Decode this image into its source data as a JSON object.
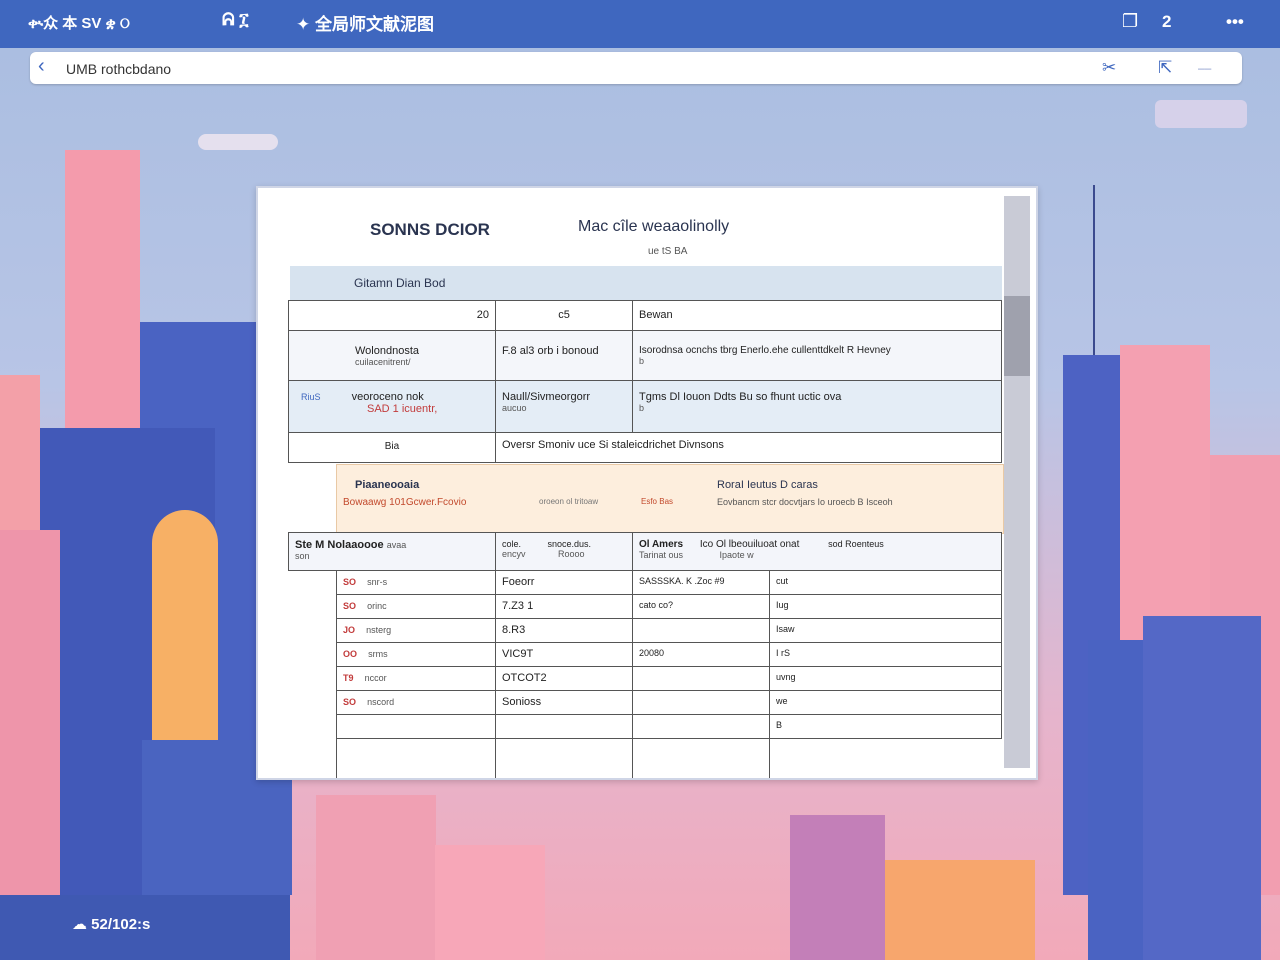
{
  "topbar": {
    "left_text": "ቊ众  本 SV  ቋ ଠ",
    "mid_icons": "ᕱ   ፲",
    "title": "✦ 全局师文献泥图",
    "right_box": "❐",
    "right_num": "2",
    "more": "•••"
  },
  "address": {
    "back": "‹",
    "url": "UMB rothcbdano",
    "icon1": "✂",
    "icon2": "⇱",
    "icon3": "––"
  },
  "doc": {
    "title": "SONNS DCIOR",
    "subtitle": "Mac cîle weaaolinolly",
    "subtitle2": "ue tS BA",
    "band": "Gitamn Dian Bod",
    "header_row": [
      "20",
      "c5",
      "Bewan"
    ],
    "rows": [
      {
        "a": "Wolondnosta",
        "a2": "cuilacenitrent/",
        "b": "F.8 al3  orb i bonoud",
        "c": "Isorodnsa  ocnchs  tbrg Enerlo.ehe  cullenttdkelt R Hevney",
        "c2": "b"
      },
      {
        "a": "veoroceno nok",
        "a2": "SAD 1 icuentr,",
        "left": "RiuS",
        "b": "Naull/Sivmeorgorr",
        "b2": "aucuo",
        "c": "Tgms  Dl Iouon Ddts  Bu so fhunt  uctic ova",
        "c2": "b"
      },
      {
        "a": "Bia",
        "b": "Oversr Smoniv uce  Si staleicdrichet Divnsons"
      }
    ],
    "section": {
      "a": "Piaaneooaia",
      "a2": "Bowaawg  101Gcwer.Fcovio",
      "b2": "oroeon ol tritoaw",
      "b3": "Esfo  Bas",
      "c": "RoraI Ieutus  D caras",
      "c2": "Eovbancm  stcr docvtjars  Io  uroecb  B Isceoh"
    },
    "subheader": {
      "a": "Ste M  Nolaaoooe",
      "a_small": "avaa",
      "a3": "son",
      "b": "cole.",
      "b_small": "encyv",
      "b3": "snoce.dus.",
      "b4": "Roooo",
      "c": "Ol Amers",
      "c_small": "Tarinat ous",
      "d": "Ico  Ol lbeouiluoat onat",
      "d2": "Ipaote w",
      "e": "sod  Roenteus"
    },
    "list": [
      {
        "n": "SO",
        "k": "snr-s",
        "v": "Foeorr",
        "w": "SASSSKA. K  .Zoc #9",
        "x": "cut"
      },
      {
        "n": "SO",
        "k": "orinc",
        "v": "7.Z3 1",
        "w": "cato    co?",
        "x": "Iug"
      },
      {
        "n": "JO",
        "k": "nsterg",
        "v": "8.R3",
        "w": "",
        "x": "Isaw"
      },
      {
        "n": "OO",
        "k": "srms",
        "v": "VIC9T",
        "w": "20080",
        "x": "I rS"
      },
      {
        "n": "T9",
        "k": "nccor",
        "v": "OTCOT2",
        "w": "",
        "x": "uvng"
      },
      {
        "n": "SO",
        "k": "nscord",
        "v": "Sonioss",
        "w": "",
        "x": "we"
      },
      {
        "n": "",
        "k": "",
        "v": "",
        "w": "",
        "x": "B"
      }
    ]
  },
  "bottombar": {
    "text": "☁ 52/102:s"
  },
  "colors": {
    "topbar": "#3f67bf",
    "sky": "#a9bde0",
    "pink": "#f6a3ad",
    "blue": "#4a63c2",
    "orange": "#f7b065"
  }
}
